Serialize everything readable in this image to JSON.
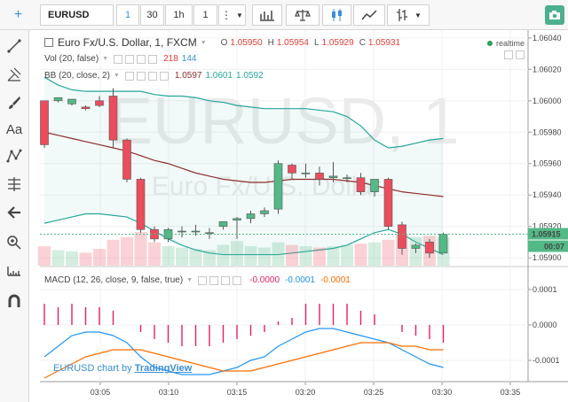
{
  "toolbar": {
    "symbol": "EURUSD",
    "intervals": [
      "1",
      "30",
      "1h",
      "1"
    ],
    "more_icon": "vertical-dots-icon",
    "tools": [
      "bar-chart-icon",
      "balance-scale-icon",
      "candlestick-icon",
      "line-chart-icon",
      "bar-type-icon"
    ],
    "snapshot_icon": "camera-icon"
  },
  "left_tools": [
    "crosshair-icon",
    "trend-line-icon",
    "pitchfork-icon",
    "brush-icon",
    "text-icon",
    "pattern-icon",
    "fib-icon",
    "back-arrow-icon",
    "zoom-icon",
    "measure-icon",
    "magnet-icon"
  ],
  "watermark": {
    "main": "EURUSD, 1",
    "sub": "Euro Fx/U.S. Dollar"
  },
  "legend": {
    "title": "Euro Fx/U.S. Dollar, 1, FXCM",
    "o_label": "O",
    "o": "1.05950",
    "h_label": "H",
    "h": "1.05954",
    "l_label": "L",
    "l": "1.05929",
    "c_label": "C",
    "c": "1.05931",
    "realtime": "realtime",
    "vol_label": "Vol (20, false)",
    "vol_a": "218",
    "vol_b": "144",
    "bb_label": "BB (20, close, 2)",
    "bb_a": "1.0597",
    "bb_b": "1.0601",
    "bb_c": "1.0592",
    "macd_label": "MACD (12, 26, close, 9, false, true)",
    "macd_a": "-0.0000",
    "macd_b": "-0.0001",
    "macd_c": "-0.0001"
  },
  "price_axis": [
    "1.06040",
    "1.06020",
    "1.06000",
    "1.05980",
    "1.05960",
    "1.05940",
    "1.05920",
    "1.05900"
  ],
  "price_marker": "1.05915",
  "countdown": "00:07",
  "macd_axis": [
    "0.0001",
    "0.0000",
    "-0.0001"
  ],
  "time_axis": [
    "03:05",
    "03:10",
    "03:15",
    "03:20",
    "03:25",
    "03:30",
    "03:35"
  ],
  "branding": {
    "prefix": "EURUSD chart by ",
    "brand": "TradingView"
  },
  "colors": {
    "up": "#53b987",
    "down": "#eb4d5c",
    "bb_band": "#26a69a",
    "bb_mid": "#8d2c2c",
    "volume": "#90caf9",
    "macd_hist": "#e91e63",
    "macd_line": "#2196f3",
    "signal_line": "#ff6d00"
  },
  "chart_data": {
    "type": "candlestick",
    "symbol": "EURUSD",
    "interval": "1",
    "x_ticks": [
      "03:05",
      "03:10",
      "03:15",
      "03:20",
      "03:25",
      "03:30",
      "03:35"
    ],
    "ylim": [
      1.05895,
      1.06045
    ],
    "candles": [
      {
        "o": 1.06,
        "h": 1.06,
        "c": 1.05972,
        "l": 1.0597
      },
      {
        "o": 1.06,
        "h": 1.06001,
        "c": 1.06002,
        "l": 1.05999
      },
      {
        "o": 1.05998,
        "h": 1.06001,
        "c": 1.06001,
        "l": 1.05997
      },
      {
        "o": 1.05996,
        "h": 1.05997,
        "c": 1.05995,
        "l": 1.05994
      },
      {
        "o": 1.06,
        "h": 1.06003,
        "c": 1.05997,
        "l": 1.05996
      },
      {
        "o": 1.06003,
        "h": 1.06008,
        "c": 1.05975,
        "l": 1.0597
      },
      {
        "o": 1.05975,
        "h": 1.05976,
        "c": 1.0595,
        "l": 1.05948
      },
      {
        "o": 1.0595,
        "h": 1.05951,
        "c": 1.05918,
        "l": 1.05916
      },
      {
        "o": 1.05918,
        "h": 1.0592,
        "c": 1.05912,
        "l": 1.0591
      },
      {
        "o": 1.05912,
        "h": 1.05919,
        "c": 1.05918,
        "l": 1.0591
      },
      {
        "o": 1.05917,
        "h": 1.0592,
        "c": 1.05917,
        "l": 1.05913
      },
      {
        "o": 1.05917,
        "h": 1.05921,
        "c": 1.05917,
        "l": 1.05914
      },
      {
        "o": 1.05916,
        "h": 1.05919,
        "c": 1.05916,
        "l": 1.05912
      },
      {
        "o": 1.0592,
        "h": 1.05923,
        "c": 1.05923,
        "l": 1.05918
      },
      {
        "o": 1.05924,
        "h": 1.05926,
        "c": 1.05925,
        "l": 1.05912
      },
      {
        "o": 1.05925,
        "h": 1.0593,
        "c": 1.05928,
        "l": 1.05922
      },
      {
        "o": 1.05928,
        "h": 1.05932,
        "c": 1.0593,
        "l": 1.05926
      },
      {
        "o": 1.05931,
        "h": 1.05962,
        "c": 1.0596,
        "l": 1.05928
      },
      {
        "o": 1.05959,
        "h": 1.0596,
        "c": 1.05954,
        "l": 1.0595
      },
      {
        "o": 1.05954,
        "h": 1.0596,
        "c": 1.05954,
        "l": 1.05951
      },
      {
        "o": 1.05954,
        "h": 1.05958,
        "c": 1.0595,
        "l": 1.05946
      },
      {
        "o": 1.05951,
        "h": 1.05961,
        "c": 1.05952,
        "l": 1.05948
      },
      {
        "o": 1.05951,
        "h": 1.05953,
        "c": 1.05951,
        "l": 1.05948
      },
      {
        "o": 1.05951,
        "h": 1.05954,
        "c": 1.05942,
        "l": 1.0594
      },
      {
        "o": 1.05942,
        "h": 1.0595,
        "c": 1.0595,
        "l": 1.05939
      },
      {
        "o": 1.0595,
        "h": 1.05951,
        "c": 1.0592,
        "l": 1.05918
      },
      {
        "o": 1.05921,
        "h": 1.05923,
        "c": 1.05906,
        "l": 1.05902
      },
      {
        "o": 1.05906,
        "h": 1.05909,
        "c": 1.05908,
        "l": 1.05903
      },
      {
        "o": 1.0591,
        "h": 1.05912,
        "c": 1.05903,
        "l": 1.059
      },
      {
        "o": 1.05903,
        "h": 1.05916,
        "c": 1.05915,
        "l": 1.05903
      }
    ],
    "volume": [
      150,
      120,
      110,
      100,
      130,
      200,
      220,
      260,
      180,
      150,
      140,
      130,
      120,
      160,
      190,
      150,
      140,
      180,
      160,
      150,
      140,
      150,
      160,
      170,
      180,
      200,
      240,
      220,
      230,
      218
    ],
    "bb_upper": [
      1.06015,
      1.0601,
      1.06007,
      1.06006,
      1.06006,
      1.06006,
      1.06006,
      1.06006,
      1.06004,
      1.06003,
      1.06003,
      1.06002,
      1.06,
      1.05999,
      1.05997,
      1.05996,
      1.05995,
      1.05995,
      1.05995,
      1.05995,
      1.05994,
      1.05993,
      1.0599,
      1.05984,
      1.05975,
      1.0597,
      1.05971,
      1.05973,
      1.05975,
      1.05976
    ],
    "bb_mid": [
      1.0598,
      1.05978,
      1.05976,
      1.05974,
      1.05972,
      1.0597,
      1.05968,
      1.05965,
      1.05962,
      1.0596,
      1.05957,
      1.05954,
      1.05952,
      1.0595,
      1.05949,
      1.05948,
      1.05948,
      1.05949,
      1.0595,
      1.0595,
      1.0595,
      1.0595,
      1.05949,
      1.05948,
      1.05946,
      1.05944,
      1.05942,
      1.05941,
      1.0594,
      1.05939
    ],
    "bb_lower": [
      1.05922,
      1.05924,
      1.05926,
      1.05928,
      1.05928,
      1.05927,
      1.05926,
      1.05922,
      1.05917,
      1.05912,
      1.05908,
      1.05905,
      1.05903,
      1.05902,
      1.05902,
      1.05902,
      1.05902,
      1.05902,
      1.05903,
      1.05904,
      1.05905,
      1.05906,
      1.05908,
      1.05912,
      1.05916,
      1.05918,
      1.05915,
      1.0591,
      1.05906,
      1.05902
    ],
    "macd_ylim": [
      -0.00016,
      0.00016
    ],
    "macd_hist": [
      6e-05,
      5e-05,
      6e-05,
      5e-05,
      5e-05,
      4e-05,
      0.0,
      -2e-05,
      -4e-05,
      -5e-05,
      -6e-05,
      -6e-05,
      -6e-05,
      -5e-05,
      -4e-05,
      -3e-05,
      -2e-05,
      1e-05,
      2e-05,
      6e-05,
      6e-05,
      6e-05,
      6e-05,
      4e-05,
      3e-05,
      0.0,
      -2e-05,
      -3e-05,
      -4e-05,
      -5e-05
    ],
    "macd_line": [
      -9e-05,
      -6e-05,
      -3e-05,
      -2e-05,
      -2e-05,
      -3e-05,
      -5e-05,
      -9e-05,
      -0.00012,
      -0.00013,
      -0.00014,
      -0.00014,
      -0.00014,
      -0.00013,
      -0.00012,
      -0.0001,
      -9e-05,
      -6e-05,
      -4e-05,
      -2e-05,
      -1e-05,
      -1e-05,
      -2e-05,
      -3e-05,
      -4e-05,
      -5e-05,
      -7e-05,
      -9e-05,
      -0.00011,
      -0.00012
    ],
    "signal_line": [
      -0.00015,
      -0.00013,
      -0.00011,
      -9e-05,
      -8e-05,
      -7e-05,
      -7e-05,
      -7e-05,
      -8e-05,
      -9e-05,
      -0.0001,
      -0.00011,
      -0.00012,
      -0.00013,
      -0.00013,
      -0.00013,
      -0.00012,
      -0.00011,
      -0.0001,
      -9e-05,
      -8e-05,
      -7e-05,
      -6e-05,
      -5e-05,
      -5e-05,
      -5e-05,
      -6e-05,
      -6e-05,
      -7e-05,
      -7e-05
    ]
  }
}
